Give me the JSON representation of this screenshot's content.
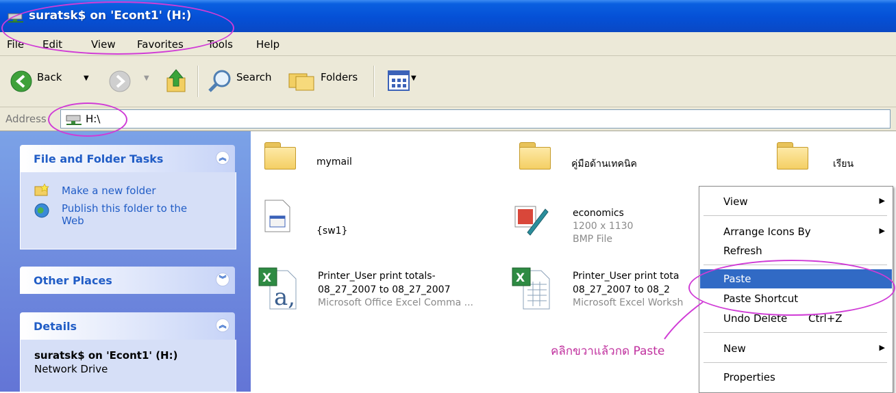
{
  "window": {
    "title": "suratsk$ on 'Econt1' (H:)"
  },
  "menubar": {
    "items": [
      "File",
      "Edit",
      "View",
      "Favorites",
      "Tools",
      "Help"
    ]
  },
  "toolbar": {
    "back_label": "Back",
    "search_label": "Search",
    "folders_label": "Folders"
  },
  "address": {
    "label": "Address",
    "value": "H:\\"
  },
  "left_pane": {
    "file_tasks": {
      "title": "File and Folder Tasks",
      "items": [
        "Make a new folder",
        "Publish this folder to the",
        "Web"
      ]
    },
    "other_places": {
      "title": "Other Places"
    },
    "details": {
      "title": "Details",
      "name": "suratsk$ on 'Econt1' (H:)",
      "type": "Network Drive"
    }
  },
  "files": [
    {
      "name": "mymail"
    },
    {
      "name": "คู่มือด้านเทคนิค"
    },
    {
      "name": "เรียน"
    },
    {
      "name": "{sw1}"
    },
    {
      "name": "economics",
      "line2": "1200 x 1130",
      "line3": "BMP File"
    },
    {
      "name": "Printer_User print totals-",
      "line2": "08_27_2007 to 08_27_2007",
      "line3": "Microsoft Office Excel Comma ..."
    },
    {
      "name": "Printer_User print tota",
      "line2": "08_27_2007 to 08_2",
      "line3": "Microsoft Excel Worksh"
    }
  ],
  "context_menu": {
    "items": [
      "View",
      "Arrange Icons By",
      "Refresh",
      "Paste",
      "Paste Shortcut",
      "Undo Delete",
      "New",
      "Properties"
    ],
    "undo_shortcut": "Ctrl+Z",
    "selected": "Paste"
  },
  "annotation": {
    "text": "คลิกขวาแล้วกด Paste",
    "color": "#c0309e"
  }
}
